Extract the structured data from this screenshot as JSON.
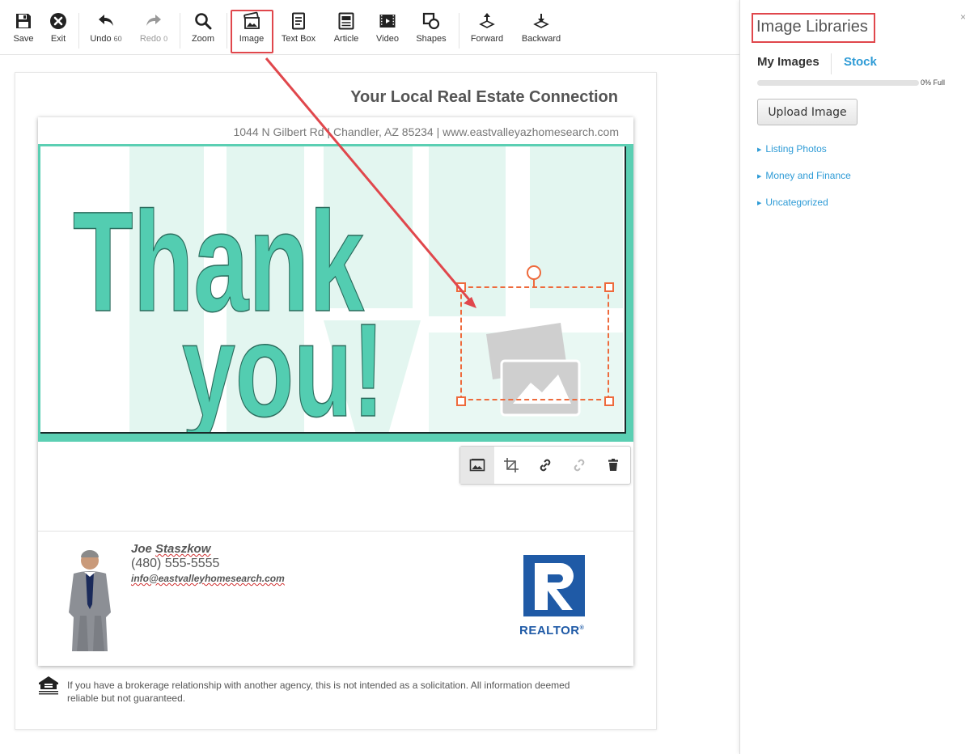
{
  "toolbar": {
    "save": "Save",
    "exit": "Exit",
    "undo": "Undo",
    "undo_count": "60",
    "redo": "Redo",
    "redo_count": "0",
    "zoom": "Zoom",
    "image": "Image",
    "textbox": "Text Box",
    "article": "Article",
    "video": "Video",
    "shapes": "Shapes",
    "forward": "Forward",
    "backward": "Backward"
  },
  "document": {
    "headline": "Your Local Real Estate Connection",
    "address": "1044 N Gilbert Rd | Chandler, AZ 85234 | www.eastvalleyazhomesearch.com",
    "banner_text_line1": "Thank",
    "banner_text_line2": "you!",
    "agent_first": "Joe",
    "agent_last": "Staszkow",
    "agent_phone": "(480) 555-5555",
    "agent_email": "info@eastvalleyhomesearch.com",
    "realtor_label": "REALTOR",
    "realtor_mark": "®",
    "disclaimer": "If you have a brokerage relationship with another agency, this is not intended as a solicitation. All information deemed reliable but not guaranteed."
  },
  "panel": {
    "close": "×",
    "title": "Image Libraries",
    "tab_my": "My Images",
    "tab_stock": "Stock",
    "usage_percent": 0,
    "usage_text": "0% Full",
    "upload_label": "Upload Image",
    "libraries": [
      "Listing Photos",
      "Money and Finance",
      "Uncategorized"
    ]
  },
  "colors": {
    "accent_red": "#e0474c",
    "selection_orange": "#ee6a3c",
    "banner_teal": "#5bcfb3",
    "link_blue": "#2e9bd6",
    "realtor_blue": "#1f5aa6"
  },
  "icons": {
    "save": "save-icon",
    "exit": "close-circle-icon",
    "undo": "undo-icon",
    "redo": "redo-icon",
    "zoom": "magnifier-icon",
    "image": "image-icon",
    "textbox": "textbox-icon",
    "article": "article-icon",
    "video": "video-icon",
    "shapes": "shapes-icon",
    "forward": "bring-forward-icon",
    "backward": "send-backward-icon"
  }
}
